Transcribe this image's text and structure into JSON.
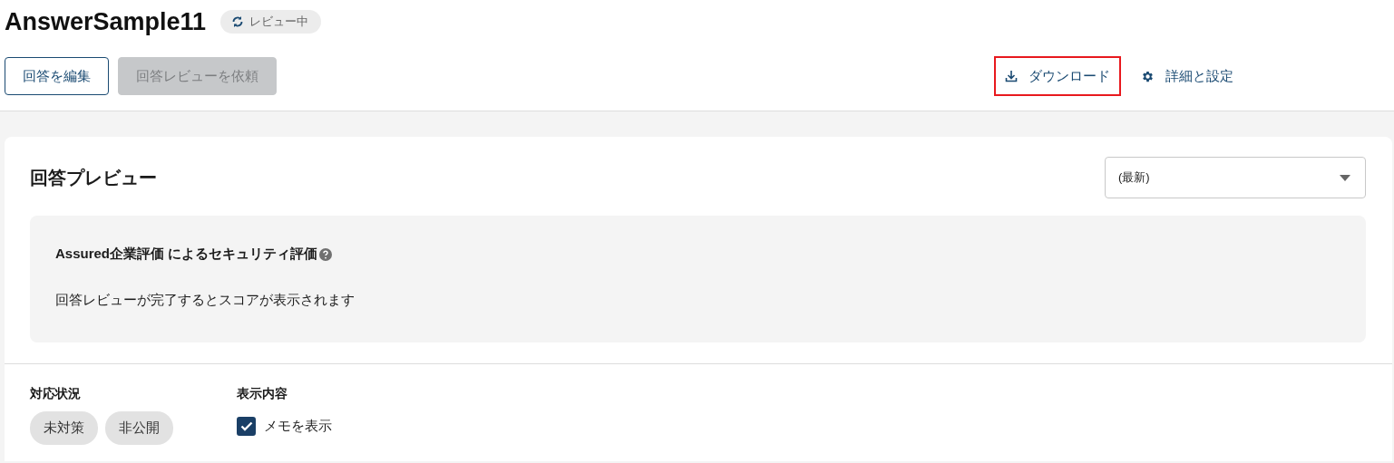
{
  "header": {
    "title": "AnswerSample11",
    "status_badge": "レビュー中"
  },
  "buttons": [
    {
      "label": "回答を編集",
      "disabled": false
    },
    {
      "label": "回答レビューを依頼",
      "disabled": true
    }
  ],
  "actions": [
    {
      "kind": "download",
      "label": "ダウンロード",
      "highlighted": true
    },
    {
      "kind": "settings",
      "label": "詳細と設定",
      "highlighted": false
    }
  ],
  "preview": {
    "title": "回答プレビュー",
    "version_select": {
      "value": "(最新)"
    },
    "score_box": {
      "heading": "Assured企業評価 によるセキュリティ評価",
      "message": "回答レビューが完了するとスコアが表示されます"
    }
  },
  "filters": {
    "status": {
      "label": "対応状況",
      "chips": [
        "未対策",
        "非公開"
      ]
    },
    "display": {
      "label": "表示内容",
      "options": [
        {
          "label": "メモを表示",
          "checked": true
        }
      ]
    }
  }
}
